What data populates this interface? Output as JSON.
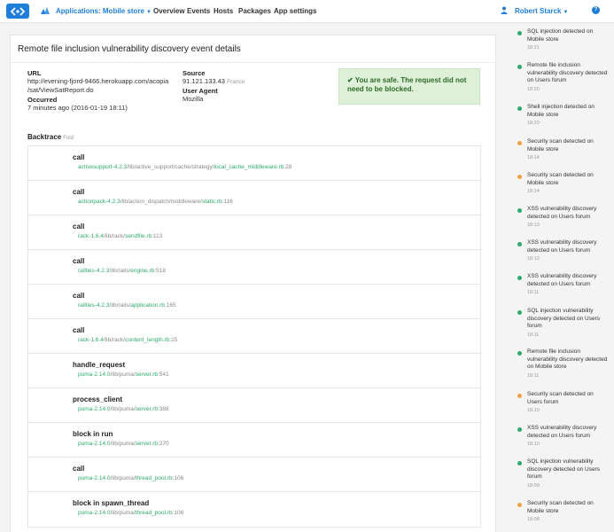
{
  "nav": {
    "app_label": "Applications: Mobile store",
    "links": [
      "Overview",
      "Events",
      "Hosts",
      "Packages",
      "App settings"
    ],
    "user": "Robert Starck",
    "brand_color": "#1f7fd8"
  },
  "panel": {
    "title": "Remote file inclusion vulnerability discovery event details",
    "url_label": "URL",
    "url_line1": "http://evening-fjord-9466.herokuapp.com/acopia",
    "url_line2": "/sat/ViewSatReport.do",
    "occurred_label": "Occurred",
    "occurred_value": "7 minutes ago (2016-01-19 18:11)",
    "source_label": "Source",
    "source_ip": "91.121.133.43",
    "source_country": "France",
    "agent_label": "User Agent",
    "agent_value": "Mozilla",
    "safe_message": "You are safe. The request did not need to be blocked.",
    "backtrace_label": "Backtrace",
    "fold_label": "Fold"
  },
  "backtrace": [
    {
      "fn": "call",
      "gem": "activesupport-4.2.3",
      "dir": "/lib/active_support/cache/strategy/",
      "file": "local_cache_middleware.rb",
      "line": ":28"
    },
    {
      "fn": "call",
      "gem": "actionpack-4.2.3",
      "dir": "/lib/action_dispatch/middleware/",
      "file": "static.rb",
      "line": ":116"
    },
    {
      "fn": "call",
      "gem": "rack-1.6.4",
      "dir": "/lib/rack/",
      "file": "sendfile.rb",
      "line": ":113"
    },
    {
      "fn": "call",
      "gem": "railties-4.2.3",
      "dir": "/lib/rails/",
      "file": "engine.rb",
      "line": ":518"
    },
    {
      "fn": "call",
      "gem": "railties-4.2.3",
      "dir": "/lib/rails/",
      "file": "application.rb",
      "line": ":165"
    },
    {
      "fn": "call",
      "gem": "rack-1.6.4",
      "dir": "/lib/rack/",
      "file": "content_length.rb",
      "line": ":15"
    },
    {
      "fn": "handle_request",
      "gem": "puma-2.14.0",
      "dir": "/lib/puma/",
      "file": "server.rb",
      "line": ":541"
    },
    {
      "fn": "process_client",
      "gem": "puma-2.14.0",
      "dir": "/lib/puma/",
      "file": "server.rb",
      "line": ":388"
    },
    {
      "fn": "block in run",
      "gem": "puma-2.14.0",
      "dir": "/lib/puma/",
      "file": "server.rb",
      "line": ":270"
    },
    {
      "fn": "call",
      "gem": "puma-2.14.0",
      "dir": "/lib/puma/",
      "file": "thread_pool.rb",
      "line": ":106"
    },
    {
      "fn": "block in spawn_thread",
      "gem": "puma-2.14.0",
      "dir": "/lib/puma/",
      "file": "thread_pool.rb",
      "line": ":106"
    }
  ],
  "status_colors": {
    "green": "#2eaa6b",
    "orange": "#f0a040"
  },
  "events": [
    {
      "text": "SQL injection detected on Mobile store",
      "time": "18:21",
      "color": "green"
    },
    {
      "text": "Remote file inclusion vulnerability discovery detected on Users forum",
      "time": "18:20",
      "color": "green"
    },
    {
      "text": "Shell injection detected on Mobile store",
      "time": "18:20",
      "color": "green"
    },
    {
      "text": "Security scan detected on Mobile store",
      "time": "18:14",
      "color": "orange"
    },
    {
      "text": "Security scan detected on Mobile store",
      "time": "18:14",
      "color": "orange"
    },
    {
      "text": "XSS vulnerability discovery detected on Users forum",
      "time": "18:13",
      "color": "green"
    },
    {
      "text": "XSS vulnerability discovery detected on Users forum",
      "time": "18:12",
      "color": "green"
    },
    {
      "text": "XSS vulnerability discovery detected on Users forum",
      "time": "18:11",
      "color": "green"
    },
    {
      "text": "SQL injection vulnerability discovery detected on Users forum",
      "time": "18:11",
      "color": "green"
    },
    {
      "text": "Remote file inclusion vulnerability discovery detected on Mobile store",
      "time": "18:11",
      "color": "green"
    },
    {
      "text": "Security scan detected on Users forum",
      "time": "18:10",
      "color": "orange"
    },
    {
      "text": "XSS vulnerability discovery detected on Users forum",
      "time": "18:10",
      "color": "green"
    },
    {
      "text": "SQL injection vulnerability discovery detected on Users forum",
      "time": "18:09",
      "color": "green"
    },
    {
      "text": "Security scan detected on Mobile store",
      "time": "18:08",
      "color": "orange"
    }
  ]
}
